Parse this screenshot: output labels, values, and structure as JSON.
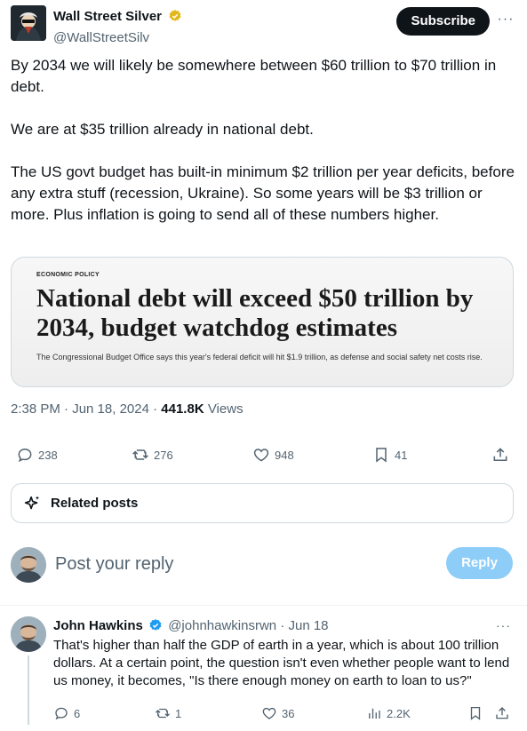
{
  "author": {
    "display_name": "Wall Street Silver",
    "handle": "@WallStreetSilv"
  },
  "subscribe_label": "Subscribe",
  "more_label": "···",
  "tweet": {
    "paragraphs": [
      "By 2034 we will likely be somewhere between $60 trillion to $70 trillion in debt.",
      "We are at $35 trillion already in national debt.",
      "The US govt budget has built-in minimum $2 trillion per year deficits, before any extra stuff (recession, Ukraine). So some years will be $3 trillion or more. Plus inflation is going to send all of these numbers higher."
    ]
  },
  "card": {
    "kicker": "ECONOMIC POLICY",
    "headline": "National debt will exceed $50 trillion by 2034, budget watchdog estimates",
    "subhead": "The Congressional Budget Office says this year's federal deficit will hit $1.9 trillion, as defense and social safety net costs rise."
  },
  "meta": {
    "timestamp": "2:38 PM · Jun 18, 2024",
    "separator": " · ",
    "views_count": "441.8K",
    "views_label": " Views"
  },
  "actions": {
    "replies": "238",
    "reposts": "276",
    "likes": "948",
    "bookmarks": "41"
  },
  "related_label": "Related posts",
  "reply_box": {
    "placeholder": "Post your reply",
    "button_label": "Reply"
  },
  "reply_tweet": {
    "display_name": "John Hawkins",
    "handle": "@johnhawkinsrwn",
    "date": " · Jun 18",
    "text": "That's higher than half the GDP of earth in a year, which is about 100 trillion dollars. At a certain point, the question isn't even whether people want to lend us money, it becomes, \"Is there enough money on earth to loan to us?\"",
    "replies": "6",
    "reposts": "1",
    "likes": "36",
    "views": "2.2K"
  },
  "colors": {
    "accent": "#1d9bf0",
    "verified_gold": "#e2b719",
    "verified_blue": "#1d9bf0",
    "reply_button_disabled": "#8ecdf7"
  }
}
